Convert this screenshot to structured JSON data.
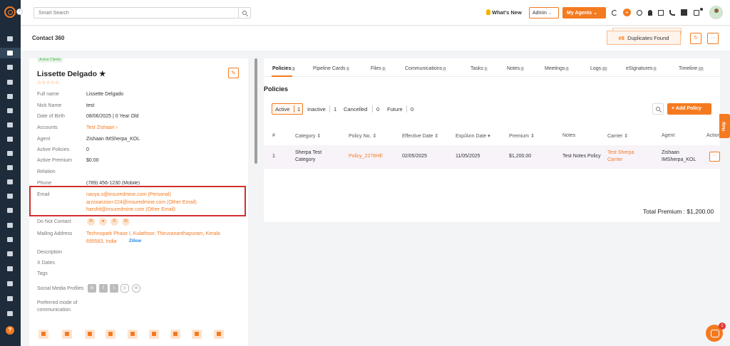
{
  "topbar": {
    "search_placeholder": "Smart Search",
    "whats_new": "What's New",
    "role": "Admin",
    "my_agents": "My Agents"
  },
  "page": {
    "title": "Contact 360",
    "duplicates": {
      "count": "#8",
      "label": "Duplicates Found"
    }
  },
  "contact": {
    "status": "Active Clients",
    "name": "Lissette Delgado",
    "star": "★",
    "rating": "☆☆☆☆☆",
    "fields": {
      "full_name": {
        "label": "Full name",
        "value": "Lissette Delgado"
      },
      "nick_name": {
        "label": "Nick Name",
        "value": "test"
      },
      "dob": {
        "label": "Date of Birth",
        "value": "08/06/2025 | 0 Year Old"
      },
      "accounts": {
        "label": "Accounts",
        "value": "Test Zishaan"
      },
      "agent": {
        "label": "Agent",
        "value": "Zishaan IMSherpa_KOL"
      },
      "active_policies": {
        "label": "Active Policies",
        "value": "0"
      },
      "active_premium": {
        "label": "Active Premium",
        "value": "$0.00"
      },
      "relation": {
        "label": "Relation",
        "value": ""
      },
      "phone": {
        "label": "Phone",
        "value": "(789) 456-1230 (Mobile)"
      },
      "email": {
        "label": "Email",
        "values": [
          "navya.s@insuredmine.com  (Personal)",
          "arzooarzoo+224@insuredmine.com  (Other Email)",
          "harshit@insuredmine.com  (Other Email)"
        ]
      },
      "do_not_contact": {
        "label": "Do Not Contact"
      },
      "mailing_address": {
        "label": "Mailing Address",
        "line1": "Technopark Phase I, Kulathoor, Thiruvananthapuram, Kerala",
        "line2": "695583, India",
        "zillow": "Zillow"
      },
      "description": {
        "label": "Description"
      },
      "x_dates": {
        "label": "X Dates"
      },
      "tags": {
        "label": "Tags"
      },
      "social": {
        "label": "Social Media Profiles"
      },
      "preferred_mode": {
        "label": "Preferred mode of communication"
      }
    }
  },
  "tabs": [
    {
      "label": "Policies",
      "count": "1"
    },
    {
      "label": "Pipeline Cards",
      "count": "0"
    },
    {
      "label": "Files",
      "count": "0"
    },
    {
      "label": "Communications",
      "count": "0"
    },
    {
      "label": "Tasks",
      "count": "1"
    },
    {
      "label": "Notes",
      "count": "0"
    },
    {
      "label": "Meetings",
      "count": "0"
    },
    {
      "label": "Logs",
      "count": "15"
    },
    {
      "label": "eSignatures",
      "count": "0"
    },
    {
      "label": "Timeline",
      "count": "19"
    }
  ],
  "policies": {
    "title": "Policies",
    "filters": [
      {
        "label": "Active",
        "count": "1"
      },
      {
        "label": "Inactive",
        "count": "1"
      },
      {
        "label": "Cancelled",
        "count": "0"
      },
      {
        "label": "Future",
        "count": "0"
      }
    ],
    "add_label": "+ Add Policy",
    "columns": [
      "#",
      "Category ⇕",
      "Policy No. ⇕",
      "Effective Date ⇕",
      "Exp/Ann Date ▾",
      "Premium ⇕",
      "Notes",
      "Carrier ⇕",
      "Agent",
      "Action"
    ],
    "rows": [
      {
        "num": "1",
        "category": [
          "Sherpa Test",
          "Category"
        ],
        "policy_no": "Policy_2276HE",
        "effective": "02/05/2025",
        "expiry": "11/05/2025",
        "premium": "$1,200.00",
        "notes": "Test Notes Policy",
        "carrier": [
          "Test Sherpa",
          "Carrier"
        ],
        "agent": [
          "Zishaan",
          "IMSherpa_KOL"
        ]
      }
    ],
    "total": "Total Premium : $1,200.00"
  },
  "help_tab": "Help",
  "chat_badge": "1"
}
